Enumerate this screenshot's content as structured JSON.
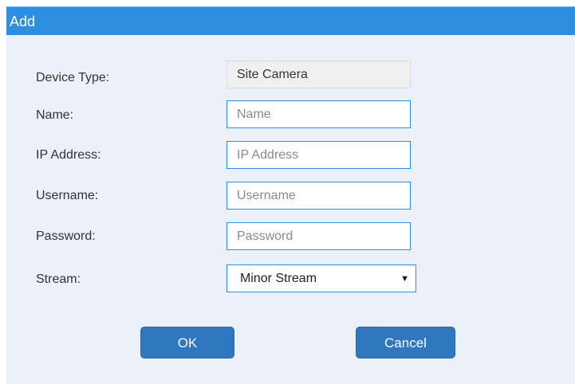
{
  "dialog": {
    "title": "Add"
  },
  "form": {
    "device_type": {
      "label": "Device Type:",
      "value": "Site Camera"
    },
    "name": {
      "label": "Name:",
      "placeholder": "Name",
      "value": ""
    },
    "ip_address": {
      "label": "IP Address:",
      "placeholder": "IP Address",
      "value": ""
    },
    "username": {
      "label": "Username:",
      "placeholder": "Username",
      "value": ""
    },
    "password": {
      "label": "Password:",
      "placeholder": "Password",
      "value": ""
    },
    "stream": {
      "label": "Stream:",
      "selected": "Minor Stream",
      "arrow": "▼"
    }
  },
  "buttons": {
    "ok": "OK",
    "cancel": "Cancel"
  },
  "colors": {
    "titlebar": "#2e8ee0",
    "dialog_background": "#ebf0f9",
    "field_border": "#2e8ee0",
    "button": "#2f78c0"
  }
}
